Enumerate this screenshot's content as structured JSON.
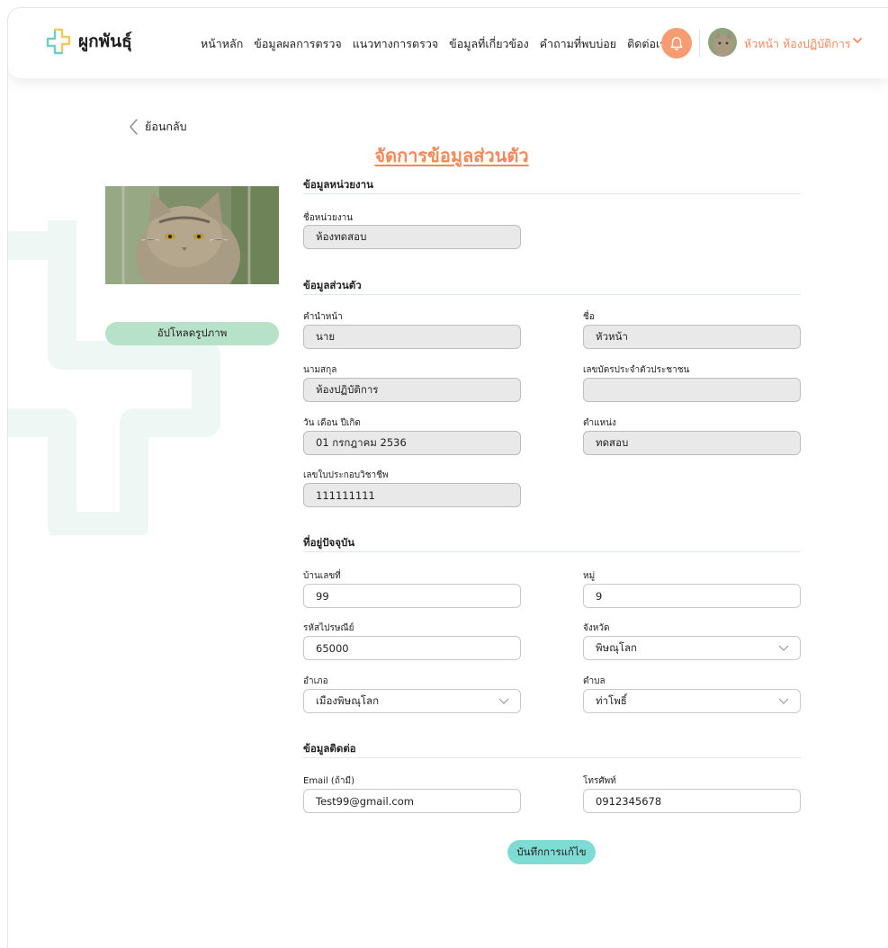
{
  "brand": {
    "name": "ผูกพันธุ์"
  },
  "nav": [
    "หน้าหลัก",
    "ข้อมูลผลการตรวจ",
    "แนวทางการตรวจ",
    "ข้อมูลที่เกี่ยวข้อง",
    "คำถามที่พบบ่อย",
    "ติดต่อเรา"
  ],
  "user": {
    "name": "หัวหน้า ห้องปฏิบัติการ"
  },
  "back_label": "ย้อนกลับ",
  "page_title": "จัดการข้อมูลส่วนตัว",
  "upload_label": "อัปโหลดรูปภาพ",
  "sections": {
    "unit": "ข้อมูลหน่วยงาน",
    "personal": "ข้อมูลส่วนตัว",
    "address": "ที่อยู่ปัจจุบัน",
    "contact": "ข้อมูลติดต่อ"
  },
  "fields": {
    "unit_name": {
      "label": "ชื่อหน่วยงาน",
      "value": "ห้องทดสอบ"
    },
    "prefix": {
      "label": "คำนำหน้า",
      "value": "นาย"
    },
    "first_name": {
      "label": "ชื่อ",
      "value": "หัวหน้า"
    },
    "last_name": {
      "label": "นามสกุล",
      "value": "ห้องปฏิบัติการ"
    },
    "id_card": {
      "label": "เลขบัตรประจำตัวประชาชน",
      "value": ""
    },
    "birth_date": {
      "label": "วัน เดือน ปีเกิด",
      "value": "01 กรกฎาคม 2536"
    },
    "position": {
      "label": "ตำแหน่ง",
      "value": "ทดสอบ"
    },
    "license": {
      "label": "เลขใบประกอบวิชาชีพ",
      "value": "111111111"
    },
    "house_no": {
      "label": "บ้านเลขที่",
      "value": "99"
    },
    "moo": {
      "label": "หมู่",
      "value": "9"
    },
    "postcode": {
      "label": "รหัสไปรษณีย์",
      "value": "65000"
    },
    "province": {
      "label": "จังหวัด",
      "value": "พิษณุโลก"
    },
    "district": {
      "label": "อำเภอ",
      "value": "เมืองพิษณุโลก"
    },
    "subdistrict": {
      "label": "ตำบล",
      "value": "ท่าโพธิ์"
    },
    "email": {
      "label": "Email (ถ้ามี)",
      "value": "Test99@gmail.com"
    },
    "phone": {
      "label": "โทรศัพท์",
      "value": "0912345678"
    }
  },
  "save_label": "บันทึกการแก้ไข",
  "colors": {
    "accent": "#f08a5d",
    "bell": "#f79b73",
    "upload": "#b7e1c9",
    "save": "#7fdcd4",
    "readonly": "#e9e9e9"
  },
  "icons": {
    "bell": "bell-icon",
    "back": "chevron-left-icon",
    "dropdown": "chevron-down-icon"
  }
}
